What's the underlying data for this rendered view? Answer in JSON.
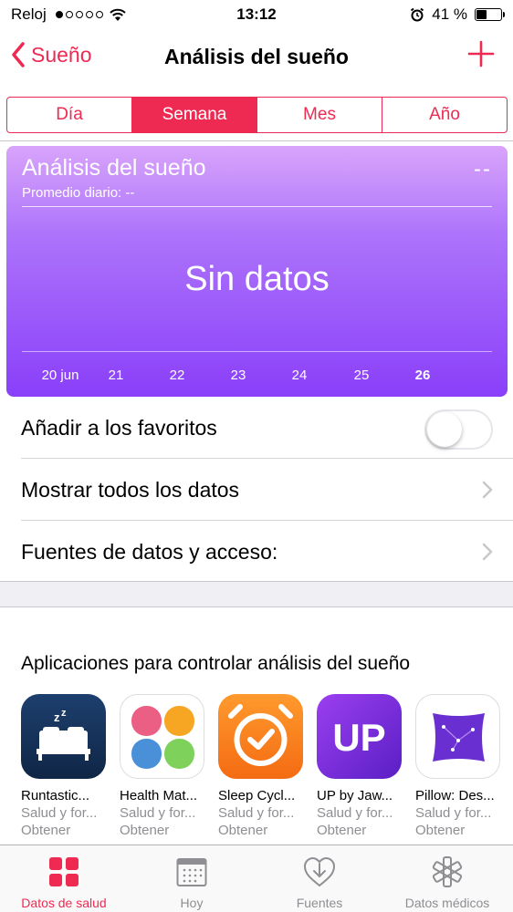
{
  "status_bar": {
    "carrier": "Reloj",
    "time": "13:12",
    "battery": "41 %",
    "signal_dots": [
      true,
      false,
      false,
      false,
      false
    ]
  },
  "nav": {
    "back_label": "Sueño",
    "title": "Análisis del sueño"
  },
  "segments": [
    {
      "label": "Día",
      "active": false
    },
    {
      "label": "Semana",
      "active": true
    },
    {
      "label": "Mes",
      "active": false
    },
    {
      "label": "Año",
      "active": false
    }
  ],
  "card": {
    "title": "Análisis del sueño",
    "value": "--",
    "subtitle": "Promedio diario: --",
    "empty_text": "Sin datos",
    "x_ticks": [
      "20 jun",
      "21",
      "22",
      "23",
      "24",
      "25",
      "26"
    ],
    "current_tick": "26"
  },
  "rows": {
    "favorites": "Añadir a los favoritos",
    "favorites_on": false,
    "show_all": "Mostrar todos los datos",
    "sources": "Fuentes de datos y acceso:"
  },
  "apps_section": {
    "title": "Aplicaciones para controlar análisis del sueño",
    "apps": [
      {
        "name": "Runtastic...",
        "category": "Salud y for...",
        "action": "Obtener",
        "icon": "sleep-bed-icon"
      },
      {
        "name": "Health Mat...",
        "category": "Salud y for...",
        "action": "Obtener",
        "icon": "four-petal-icon"
      },
      {
        "name": "Sleep Cycl...",
        "category": "Salud y for...",
        "action": "Obtener",
        "icon": "alarm-clock-icon"
      },
      {
        "name": "UP by Jaw...",
        "category": "Salud y for...",
        "action": "Obtener",
        "icon": "up-logo-icon"
      },
      {
        "name": "Pillow: Des...",
        "category": "Salud y for...",
        "action": "Obtener",
        "icon": "pillow-icon"
      }
    ]
  },
  "tabs": [
    {
      "label": "Datos de salud",
      "icon": "health-data-grid-icon",
      "active": true
    },
    {
      "label": "Hoy",
      "icon": "calendar-icon",
      "active": false
    },
    {
      "label": "Fuentes",
      "icon": "sources-download-icon",
      "active": false
    },
    {
      "label": "Datos médicos",
      "icon": "medical-asterisk-icon",
      "active": false
    }
  ],
  "colors": {
    "accent": "#ee2a52",
    "card_top": "#d9a4fb",
    "card_bottom": "#8a3ff9"
  }
}
